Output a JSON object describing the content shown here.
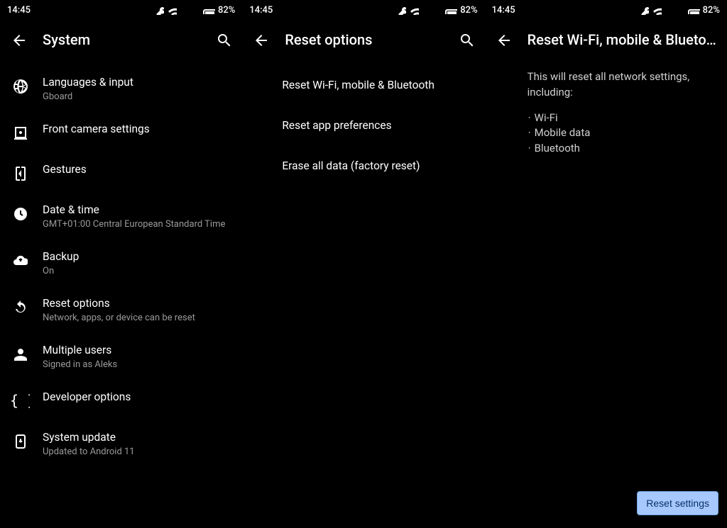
{
  "statusbar": {
    "time": "14:45",
    "battery": "82%"
  },
  "panel1": {
    "title": "System",
    "items": [
      {
        "title": "Languages & input",
        "subtitle": "Gboard"
      },
      {
        "title": "Front camera settings",
        "subtitle": ""
      },
      {
        "title": "Gestures",
        "subtitle": ""
      },
      {
        "title": "Date & time",
        "subtitle": "GMT+01:00 Central European Standard Time"
      },
      {
        "title": "Backup",
        "subtitle": "On"
      },
      {
        "title": "Reset options",
        "subtitle": "Network, apps, or device can be reset"
      },
      {
        "title": "Multiple users",
        "subtitle": "Signed in as Aleks"
      },
      {
        "title": "Developer options",
        "subtitle": ""
      },
      {
        "title": "System update",
        "subtitle": "Updated to Android 11"
      }
    ]
  },
  "panel2": {
    "title": "Reset options",
    "items": [
      {
        "title": "Reset Wi-Fi, mobile & Bluetooth"
      },
      {
        "title": "Reset app preferences"
      },
      {
        "title": "Erase all data (factory reset)"
      }
    ]
  },
  "panel3": {
    "title": "Reset Wi-Fi, mobile & Blueto…",
    "intro": "This will reset all network settings, including:",
    "bullets": [
      "Wi-Fi",
      "Mobile data",
      "Bluetooth"
    ],
    "action": "Reset settings"
  }
}
